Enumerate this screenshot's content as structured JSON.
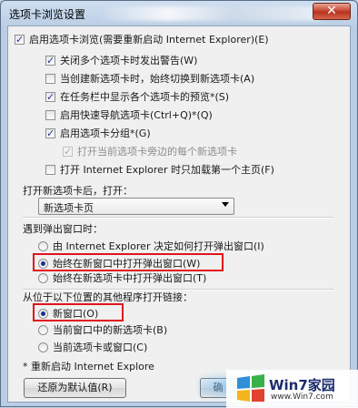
{
  "window": {
    "title": "选项卡浏览设置",
    "close_glyph": "✕"
  },
  "options": {
    "enable_tabs": {
      "label": "启用选项卡浏览(需要重新启动 Internet Explorer)(E)",
      "checked": true
    },
    "warn_close_multiple": {
      "label": "关闭多个选项卡时发出警告(W)",
      "checked": true
    },
    "switch_to_new_tab": {
      "label": "当创建新选项卡时，始终切换到新选项卡(A)",
      "checked": false
    },
    "taskbar_previews": {
      "label": "在任务栏中显示各个选项卡的预览*(S)",
      "checked": true
    },
    "quick_tabs": {
      "label": "启用快速导航选项卡(Ctrl+Q)*(Q)",
      "checked": false
    },
    "tab_groups": {
      "label": "启用选项卡分组*(G)",
      "checked": true
    },
    "open_next_to_current": {
      "label": "打开当前选项卡旁边的每个新选项卡",
      "checked": true,
      "disabled": true
    },
    "load_first_home_page": {
      "label": "打开 Internet Explorer 时只加载第一个主页(F)",
      "checked": false
    }
  },
  "new_tab_open": {
    "label": "打开新选项卡后，打开：",
    "selected": "新选项卡页"
  },
  "popups": {
    "label": "遇到弹出窗口时：",
    "items": [
      {
        "label": "由 Internet Explorer 决定如何打开弹出窗口(I)",
        "selected": false
      },
      {
        "label": "始终在新窗口中打开弹出窗口(W)",
        "selected": true
      },
      {
        "label": "始终在新选项卡中打开弹出窗口(T)",
        "selected": false
      }
    ]
  },
  "links": {
    "label": "从位于以下位置的其他程序打开链接：",
    "items": [
      {
        "label": "新窗口(O)",
        "selected": true
      },
      {
        "label": "当前窗口中的新选项卡(B)",
        "selected": false
      },
      {
        "label": "当前选项卡或窗口(C)",
        "selected": false
      }
    ]
  },
  "footnote": "* 重新启动 Internet Explore",
  "buttons": {
    "restore_defaults": "还原为默认值(R)",
    "ok_partial": "确"
  },
  "watermark": {
    "brand": "Win7家园",
    "site": "www.Win7.com"
  }
}
